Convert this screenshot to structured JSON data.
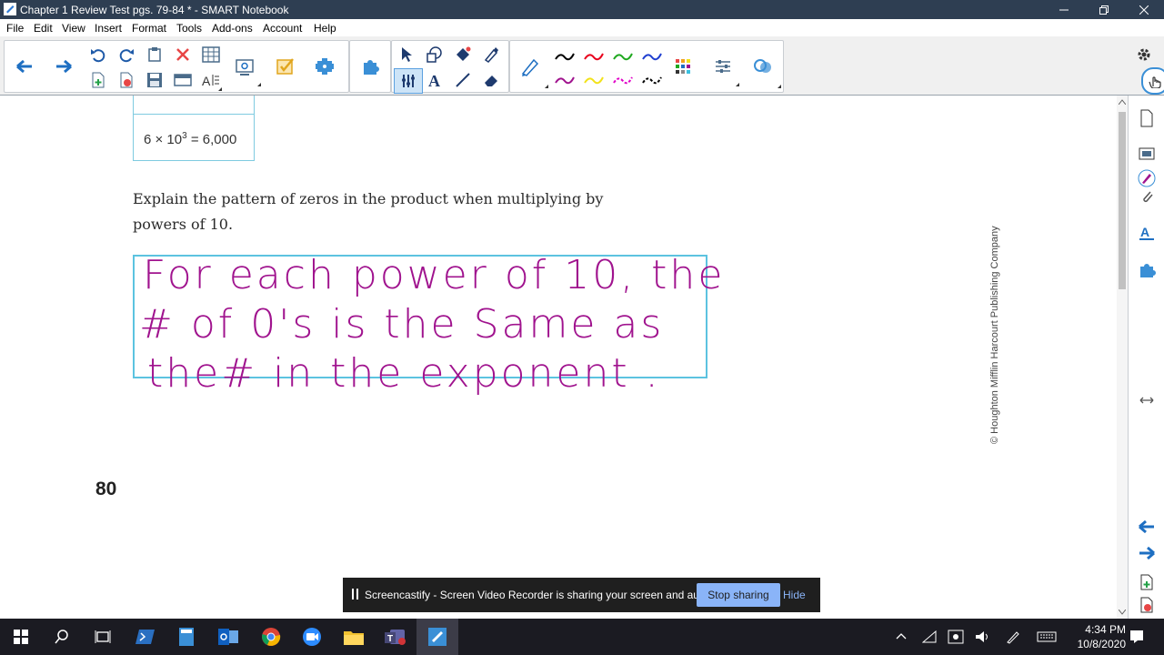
{
  "window": {
    "title": "Chapter 1 Review Test pgs. 79-84 * - SMART Notebook"
  },
  "menu": [
    "File",
    "Edit",
    "View",
    "Insert",
    "Format",
    "Tools",
    "Add-ons",
    "Account",
    "Help"
  ],
  "toolbar": {
    "icons": [
      "back-arrow-icon",
      "forward-arrow-icon",
      "undo-icon",
      "redo-icon",
      "paste-icon",
      "delete-icon",
      "table-icon",
      "add-page-icon",
      "delete-page-icon",
      "save-icon",
      "screen-shade-icon",
      "text-recognition-icon",
      "document-camera-icon",
      "response-icon",
      "activity-builder-icon",
      "addons-icon",
      "select-icon",
      "shapes-icon",
      "fill-icon",
      "pen-icon",
      "eraser-icon",
      "text-icon",
      "line-icon",
      "magic-pen-icon",
      "pen-color-icon",
      "grid-icon",
      "properties-icon",
      "collaborate-icon",
      "gear-icon"
    ],
    "pen_colors": [
      "#000000",
      "#e8001c",
      "#1fa81f",
      "#1f3fd0",
      "#a0138e",
      "#f2e21a",
      "#e100c8",
      "#000000"
    ]
  },
  "content": {
    "equation_base": "6 × 10",
    "equation_exp": "3",
    "equation_result": " = 6,000",
    "prompt": "Explain the pattern of zeros in the product when multiplying by powers of 10.",
    "handwriting": [
      "For each power of 10, the",
      "# of 0's  is the Same as",
      "the# in the exponent ."
    ],
    "handwriting_color": "#a0138e",
    "page_number": "80",
    "copyright": "© Houghton Mifflin Harcourt Publishing Company"
  },
  "share_bar": {
    "message": "Screencastify - Screen Video Recorder is sharing your screen and audio.",
    "stop_label": "Stop sharing",
    "hide_label": "Hide"
  },
  "taskbar": {
    "time": "4:34 PM",
    "date": "10/8/2020",
    "apps": [
      "start-icon",
      "search-icon",
      "task-view-icon",
      "powershell-icon",
      "calculator-icon",
      "outlook-icon",
      "chrome-icon",
      "zoom-icon",
      "file-explorer-icon",
      "teams-icon",
      "smart-notebook-icon"
    ]
  }
}
